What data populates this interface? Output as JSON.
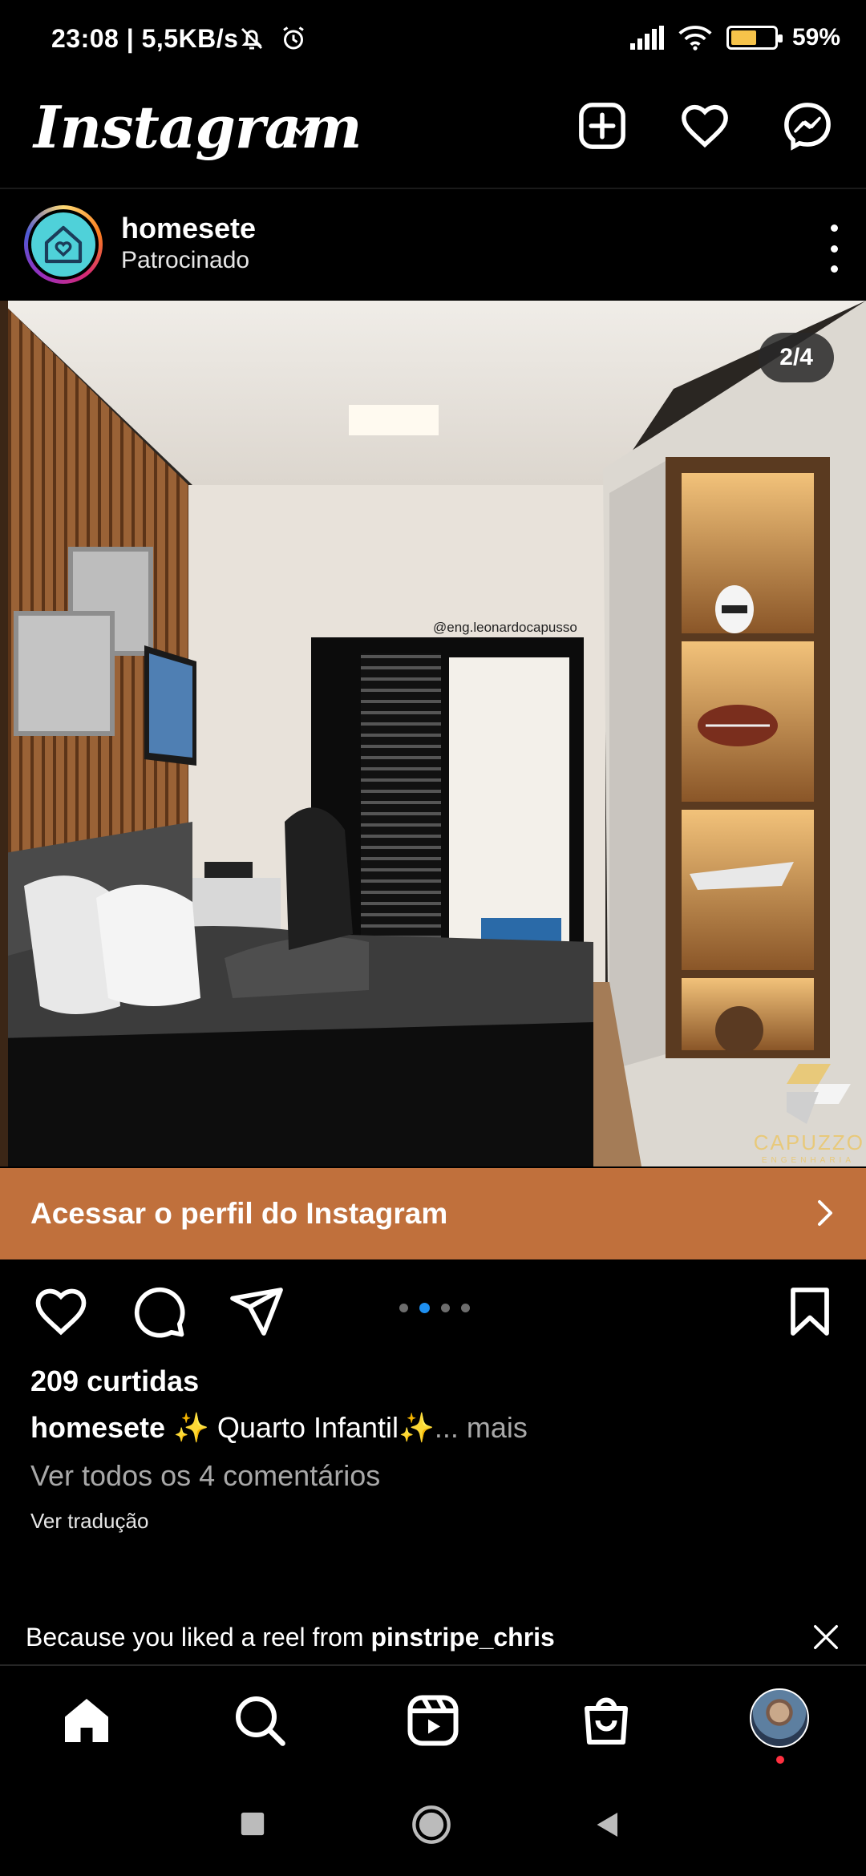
{
  "status_bar": {
    "time": "23:08 | 5,5KB/s",
    "battery_text": "59%",
    "battery_level": 0.59
  },
  "header": {
    "logo": "Instagram"
  },
  "post": {
    "username": "homesete",
    "sponsored_label": "Patrocinado",
    "carousel_counter": "2/4",
    "carousel_current": 2,
    "carousel_total": 4,
    "image_watermark": "@eng.leonardocapusso",
    "brand_logo_text": "CAPUZZO",
    "brand_logo_sub": "ENGENHARIA",
    "cta_label": "Acessar o perfil do Instagram",
    "likes": "209 curtidas",
    "caption_user": "homesete",
    "caption_text": " ✨ Quarto Infantil✨",
    "caption_more": "... mais",
    "view_comments": "Ver todos os 4 comentários",
    "translate": "Ver tradução"
  },
  "suggestion": {
    "prefix": "Because you liked a reel from ",
    "user": "pinstripe_chris"
  },
  "colors": {
    "cta_background": "#c0703c",
    "active_dot": "#1e8ff0",
    "notification_dot": "#ff3040"
  },
  "icons": {
    "status": [
      "mute-bell-icon",
      "alarm-icon",
      "signal-icon",
      "wifi-icon",
      "battery-icon"
    ],
    "header": [
      "new-post-icon",
      "heart-icon",
      "messenger-icon"
    ],
    "actions": [
      "like-icon",
      "comment-icon",
      "share-icon",
      "save-icon"
    ],
    "nav": [
      "home-icon",
      "search-icon",
      "reels-icon",
      "shop-icon",
      "profile-avatar"
    ],
    "system": [
      "recents-icon",
      "home-circle-icon",
      "back-icon"
    ]
  }
}
